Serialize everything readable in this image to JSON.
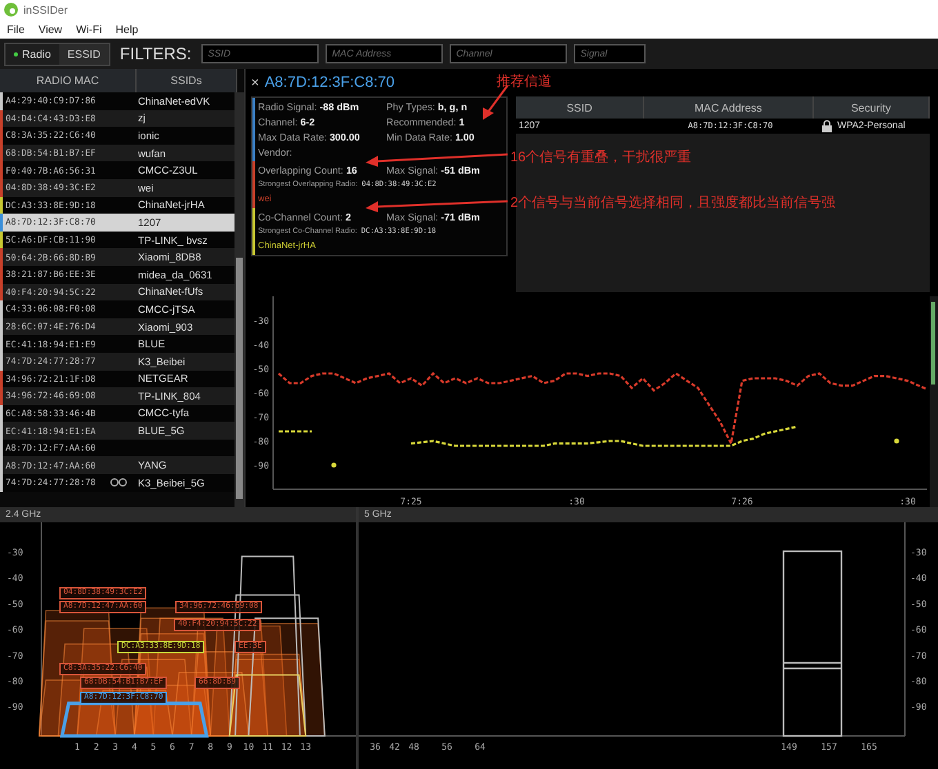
{
  "window": {
    "title": "inSSIDer"
  },
  "menu": [
    "File",
    "View",
    "Wi-Fi",
    "Help"
  ],
  "toolbar": {
    "modes": [
      {
        "label": "Radio",
        "selected": true
      },
      {
        "label": "ESSID",
        "selected": false
      }
    ],
    "filters_label": "FILTERS:",
    "filters": [
      {
        "placeholder": "SSID"
      },
      {
        "placeholder": "MAC Address"
      },
      {
        "placeholder": "Channel"
      },
      {
        "placeholder": "Signal"
      }
    ]
  },
  "networks": {
    "columns": [
      "RADIO MAC",
      "SSIDs"
    ],
    "rows": [
      {
        "mac": "A4:29:40:C9:D7:86",
        "ssid": "ChinaNet-edVK",
        "color": "#c8c8c8",
        "selected": false,
        "linked": false
      },
      {
        "mac": "04:D4:C4:43:D3:E8",
        "ssid": "zj",
        "color": "#c8402a",
        "selected": false,
        "linked": false
      },
      {
        "mac": "C8:3A:35:22:C6:40",
        "ssid": "ionic",
        "color": "#c8402a",
        "selected": false,
        "linked": false
      },
      {
        "mac": "68:DB:54:B1:B7:EF",
        "ssid": "wufan",
        "color": "#c8402a",
        "selected": false,
        "linked": false
      },
      {
        "mac": "F0:40:7B:A6:56:31",
        "ssid": "CMCC-Z3UL",
        "color": "#c8402a",
        "selected": false,
        "linked": false
      },
      {
        "mac": "04:8D:38:49:3C:E2",
        "ssid": "wei",
        "color": "#c8402a",
        "selected": false,
        "linked": false
      },
      {
        "mac": "DC:A3:33:8E:9D:18",
        "ssid": "ChinaNet-jrHA",
        "color": "#c8c832",
        "selected": false,
        "linked": false
      },
      {
        "mac": "A8:7D:12:3F:C8:70",
        "ssid": "1207",
        "color": "#3b8fd9",
        "selected": true,
        "linked": false
      },
      {
        "mac": "5C:A6:DF:CB:11:90",
        "ssid": "TP-LINK_ bvsz",
        "color": "#c8c832",
        "selected": false,
        "linked": false
      },
      {
        "mac": "50:64:2B:66:8D:B9",
        "ssid": "Xiaomi_8DB8",
        "color": "#c8402a",
        "selected": false,
        "linked": false
      },
      {
        "mac": "38:21:87:B6:EE:3E",
        "ssid": "midea_da_0631",
        "color": "#c8402a",
        "selected": false,
        "linked": false
      },
      {
        "mac": "40:F4:20:94:5C:22",
        "ssid": "ChinaNet-fUfs",
        "color": "#c8402a",
        "selected": false,
        "linked": false
      },
      {
        "mac": "C4:33:06:08:F0:08",
        "ssid": "CMCC-jTSA",
        "color": "#c8c8c8",
        "selected": false,
        "linked": false
      },
      {
        "mac": "28:6C:07:4E:76:D4",
        "ssid": "Xiaomi_903",
        "color": "#c8c8c8",
        "selected": false,
        "linked": false
      },
      {
        "mac": "EC:41:18:94:E1:E9",
        "ssid": "BLUE",
        "color": "#c8c8c8",
        "selected": false,
        "linked": false
      },
      {
        "mac": "74:7D:24:77:28:77",
        "ssid": "K3_Beibei",
        "color": "#c8c8c8",
        "selected": false,
        "linked": false
      },
      {
        "mac": "34:96:72:21:1F:D8",
        "ssid": "NETGEAR",
        "color": "#c8402a",
        "selected": false,
        "linked": false
      },
      {
        "mac": "34:96:72:46:69:08",
        "ssid": "TP-LINK_804",
        "color": "#c8402a",
        "selected": false,
        "linked": false
      },
      {
        "mac": "6C:A8:58:33:46:4B",
        "ssid": "CMCC-tyfa",
        "color": "#c8c8c8",
        "selected": false,
        "linked": false
      },
      {
        "mac": "EC:41:18:94:E1:EA",
        "ssid": "BLUE_5G",
        "color": "#c8c8c8",
        "selected": false,
        "linked": false
      },
      {
        "mac": "A8:7D:12:F7:AA:60",
        "color": "#c8c8c8",
        "selected": false,
        "linked": false
      },
      {
        "mac": "A8:7D:12:47:AA:60",
        "ssid": "YANG",
        "color": "#c8c8c8",
        "selected": false,
        "linked": false
      },
      {
        "mac": "74:7D:24:77:28:78",
        "ssid": "K3_Beibei_5G",
        "color": "#c8c8c8",
        "selected": false,
        "linked": true
      }
    ]
  },
  "detail": {
    "close": "×",
    "title": "A8:7D:12:3F:C8:70",
    "sections": [
      {
        "color": "#3b7fc4",
        "lines": [
          {
            "left": "Radio Signal: **-88 dBm**",
            "right": "Phy Types: **b, g, n**"
          },
          {
            "left": "Channel: **6-2**",
            "right": "Recommended: **1**"
          },
          {
            "left": "Max Data Rate: **300.00**",
            "right": "Min Data Rate: **1.00**"
          },
          {
            "left": "Vendor:"
          }
        ]
      },
      {
        "color": "#c8402a",
        "lines": [
          {
            "left": "Overlapping Count: **16**",
            "right": "Max Signal: **-51 dBm**"
          }
        ],
        "radio_label": "Strongest Overlapping Radio:",
        "radio_mac": "04:8D:38:49:3C:E2",
        "ssid": "wei"
      },
      {
        "color": "#c8c832",
        "lines": [
          {
            "left": "Co-Channel Count: **2**",
            "right": "Max Signal: **-71 dBm**"
          }
        ],
        "radio_label": "Strongest Co-Channel Radio:",
        "radio_mac": "DC:A3:33:8E:9D:18",
        "ssid": "ChinaNet-jrHA"
      }
    ]
  },
  "ssid_table": {
    "columns": [
      "SSID",
      "MAC Address",
      "Security"
    ],
    "rows": [
      {
        "ssid": "1207",
        "mac": "A8:7D:12:3F:C8:70",
        "security": "WPA2-Personal"
      }
    ]
  },
  "annotations": [
    {
      "text": "推荐信道"
    },
    {
      "text": "16个信号有重叠，干扰很严重"
    },
    {
      "text": "2个信号与当前信号选择相同，且强度都比当前信号强"
    }
  ],
  "signal_chart": {
    "chart_data": {
      "type": "line",
      "categories": [
        null,
        null,
        null,
        null,
        null,
        null,
        null,
        null,
        null,
        null,
        null,
        null,
        "7:25",
        null,
        null,
        null,
        null,
        null,
        null,
        null,
        null,
        null,
        null,
        null,
        null,
        null,
        null,
        ":30",
        null,
        null,
        null,
        null,
        null,
        null,
        null,
        null,
        null,
        null,
        null,
        null,
        null,
        null,
        "7:26",
        null,
        null,
        null,
        null,
        null,
        null,
        null,
        null,
        null,
        null,
        null,
        null,
        null,
        null,
        ":30",
        null,
        null
      ],
      "series": [
        {
          "color": "#d83a2a",
          "line_style": "dashed",
          "values": [
            -52,
            -56,
            -56,
            -53,
            -52,
            -52,
            -54,
            -56,
            -54,
            -53,
            -52,
            -56,
            -54,
            -57,
            -52,
            -56,
            -54,
            -56,
            -54,
            -56,
            -56,
            -55,
            -54,
            -53,
            -56,
            -55,
            -52,
            -52,
            -53,
            -52,
            -52,
            -53,
            -58,
            -54,
            -59,
            -56,
            -52,
            -55,
            -58,
            -65,
            -72,
            -81,
            -55,
            -54,
            -54,
            -54,
            -55,
            -57,
            -53,
            -52,
            -56,
            -57,
            -57,
            -55,
            -53,
            -53,
            -54,
            -55,
            -57,
            -59
          ]
        },
        {
          "color": "#d8d83a",
          "line_style": "dashed",
          "values": [
            -76,
            -76,
            -76,
            -76,
            null,
            -90,
            null,
            null,
            null,
            null,
            null,
            null,
            -81,
            -80.5,
            -80,
            -81,
            -82,
            -82,
            -82,
            -82,
            -82,
            -82,
            -82,
            -82,
            -82,
            -81,
            -81,
            -81,
            -81,
            -80.5,
            -80,
            -80,
            -81,
            -82,
            -82,
            -82,
            -82,
            -82,
            -82,
            -82,
            -82,
            -82,
            -80,
            -79,
            -77,
            -76,
            -75,
            -74,
            null,
            null,
            null,
            null,
            null,
            null,
            null,
            null,
            -80,
            null,
            null,
            null
          ]
        }
      ],
      "ylim": [
        -100,
        -20
      ],
      "yticks": [
        -30,
        -40,
        -50,
        -60,
        -70,
        -80,
        -90
      ]
    }
  },
  "bands": [
    {
      "kind": "ghz24",
      "title": "2.4 GHz",
      "yticks": [
        "-30",
        "-40",
        "-50",
        "-60",
        "-70",
        "-80",
        "-90"
      ],
      "channels": [
        "1",
        "2",
        "3",
        "4",
        "5",
        "6",
        "7",
        "8",
        "9",
        "10",
        "11",
        "12",
        "13"
      ],
      "labels": [
        {
          "text": "04:8D:38:49:3C:E2",
          "color": "#d8553a"
        },
        {
          "text": "A8:7D:12:47:AA:60",
          "color": "#d8553a"
        },
        {
          "text": "34:96:72:46:69:08",
          "color": "#d8553a"
        },
        {
          "text": "40:F4:20:94:5C:22",
          "color": "#d8553a"
        },
        {
          "text": "DC:A3:33:8E:9D:18",
          "color": "#c8d83a"
        },
        {
          "text": "EE:3E",
          "color": "#d8553a"
        },
        {
          "text": "C8:3A:35:22:C6:40",
          "color": "#d8553a"
        },
        {
          "text": "68:DB:54:B1:B7:EF",
          "color": "#d8553a"
        },
        {
          "text": "66:8D:B9",
          "color": "#d8553a"
        },
        {
          "text": "A8:7D:12:3F:C8:70",
          "color": "#4aa0e8"
        }
      ]
    },
    {
      "kind": "ghz5",
      "title": "5 GHz",
      "yticks": [
        "-30",
        "-40",
        "-50",
        "-60",
        "-70",
        "-80",
        "-90"
      ],
      "channels": [
        "36",
        "42",
        "48",
        "56",
        "64",
        "149",
        "157",
        "165"
      ]
    }
  ]
}
